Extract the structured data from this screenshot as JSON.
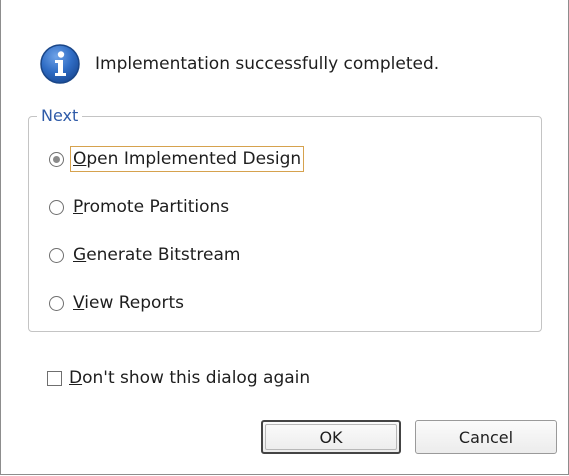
{
  "message": {
    "icon": "info-icon",
    "text": "Implementation successfully completed."
  },
  "next_group": {
    "legend": "Next",
    "options": [
      {
        "mnemonic": "O",
        "rest": "pen Implemented Design",
        "checked": true
      },
      {
        "mnemonic": "P",
        "rest": "romote Partitions",
        "checked": false
      },
      {
        "mnemonic": "G",
        "rest": "enerate Bitstream",
        "checked": false
      },
      {
        "mnemonic": "V",
        "rest": "iew Reports",
        "checked": false
      }
    ]
  },
  "dont_show": {
    "mnemonic": "D",
    "rest": "on't show this dialog again",
    "checked": false
  },
  "buttons": {
    "ok": "OK",
    "cancel": "Cancel"
  },
  "colors": {
    "legend": "#2f5ba8",
    "info_icon": "#2f6cc4",
    "focus_border": "#d6a24e"
  }
}
